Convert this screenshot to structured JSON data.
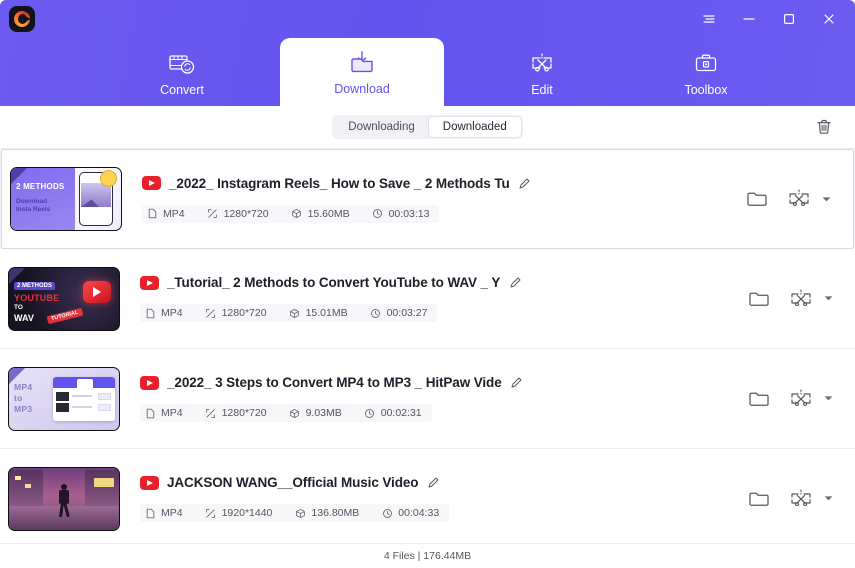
{
  "window": {
    "logo_name": "hitpaw-logo",
    "controls": [
      {
        "name": "menu-button",
        "glyph": "menu-icon"
      },
      {
        "name": "minimize-button",
        "glyph": "minimize-icon"
      },
      {
        "name": "maximize-button",
        "glyph": "maximize-icon"
      },
      {
        "name": "close-button",
        "glyph": "close-icon"
      }
    ],
    "header_color": "#6254EE"
  },
  "nav": {
    "tabs": [
      {
        "label": "Convert",
        "icon": "film-convert-icon",
        "active": false
      },
      {
        "label": "Download",
        "icon": "download-folder-icon",
        "active": true
      },
      {
        "label": "Edit",
        "icon": "edit-scissors-icon",
        "active": false
      },
      {
        "label": "Toolbox",
        "icon": "toolbox-icon",
        "active": false
      }
    ]
  },
  "toolbar": {
    "segments": [
      {
        "label": "Downloading",
        "active": false
      },
      {
        "label": "Downloaded",
        "active": true
      }
    ],
    "delete_all": {
      "name": "delete-all-button",
      "icon": "trash-icon"
    }
  },
  "list": {
    "items": [
      {
        "title": "_2022_ Instagram Reels_ How to Save _ 2 Methods Tu",
        "source_icon": "youtube-icon",
        "selected": true,
        "thumb_class": "t1",
        "thumb_text": {
          "line1": "2 METHODS",
          "line2": "Download",
          "line3": "Insta Reels"
        },
        "meta": {
          "format": "MP4",
          "resolution": "1280*720",
          "size": "15.60MB",
          "duration": "00:03:13"
        }
      },
      {
        "title": "_Tutorial_ 2 Methods to Convert YouTube to WAV _ Y",
        "source_icon": "youtube-icon",
        "selected": false,
        "thumb_class": "t2",
        "thumb_text": {
          "line1": "2 METHODS",
          "line2": "YOUTUBE",
          "line3": "TO",
          "line4": "WAV",
          "ribbon": "TUTORIAL"
        },
        "meta": {
          "format": "MP4",
          "resolution": "1280*720",
          "size": "15.01MB",
          "duration": "00:03:27"
        }
      },
      {
        "title": "_2022_ 3 Steps to Convert MP4 to MP3 _ HitPaw Vide",
        "source_icon": "youtube-icon",
        "selected": false,
        "thumb_class": "t3",
        "thumb_text": {
          "line1": "MP4",
          "line2": "to",
          "line3": "MP3"
        },
        "meta": {
          "format": "MP4",
          "resolution": "1280*720",
          "size": "9.03MB",
          "duration": "00:02:31"
        }
      },
      {
        "title": "JACKSON WANG__Official Music Video",
        "source_icon": "youtube-icon",
        "selected": false,
        "thumb_class": "t4",
        "thumb_text": {},
        "meta": {
          "format": "MP4",
          "resolution": "1920*1440",
          "size": "136.80MB",
          "duration": "00:04:33"
        }
      }
    ],
    "row_actions": [
      {
        "name": "open-folder-button",
        "icon": "folder-icon"
      },
      {
        "name": "edit-video-button",
        "icon": "edit-scissors-icon"
      },
      {
        "name": "more-actions-dropdown",
        "icon": "chevron-down-icon"
      }
    ],
    "meta_icons": {
      "format": "file-icon",
      "resolution": "resize-icon",
      "size": "box-icon",
      "duration": "clock-icon"
    },
    "rename_icon": "pencil-icon"
  },
  "status": {
    "text": "4 Files | 176.44MB"
  }
}
